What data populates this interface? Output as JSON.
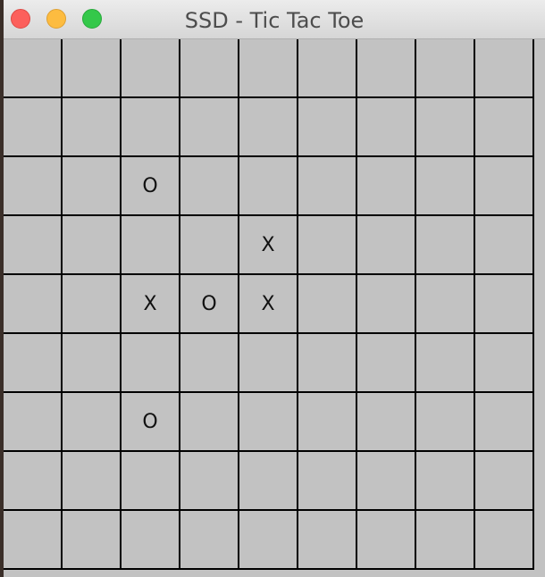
{
  "window": {
    "title": "SSD - Tic Tac Toe"
  },
  "colors": {
    "board_background": "#c2c2c2",
    "grid_line": "#000000",
    "close_button": "#fc605c",
    "minimize_button": "#fdbc40",
    "maximize_button": "#34c84a"
  },
  "board": {
    "rows": 9,
    "cols": 9,
    "cells": [
      [
        "",
        "",
        "",
        "",
        "",
        "",
        "",
        "",
        ""
      ],
      [
        "",
        "",
        "",
        "",
        "",
        "",
        "",
        "",
        ""
      ],
      [
        "",
        "",
        "O",
        "",
        "",
        "",
        "",
        "",
        ""
      ],
      [
        "",
        "",
        "",
        "",
        "X",
        "",
        "",
        "",
        ""
      ],
      [
        "",
        "",
        "X",
        "O",
        "X",
        "",
        "",
        "",
        ""
      ],
      [
        "",
        "",
        "",
        "",
        "",
        "",
        "",
        "",
        ""
      ],
      [
        "",
        "",
        "O",
        "",
        "",
        "",
        "",
        "",
        ""
      ],
      [
        "",
        "",
        "",
        "",
        "",
        "",
        "",
        "",
        ""
      ],
      [
        "",
        "",
        "",
        "",
        "",
        "",
        "",
        "",
        ""
      ]
    ]
  }
}
